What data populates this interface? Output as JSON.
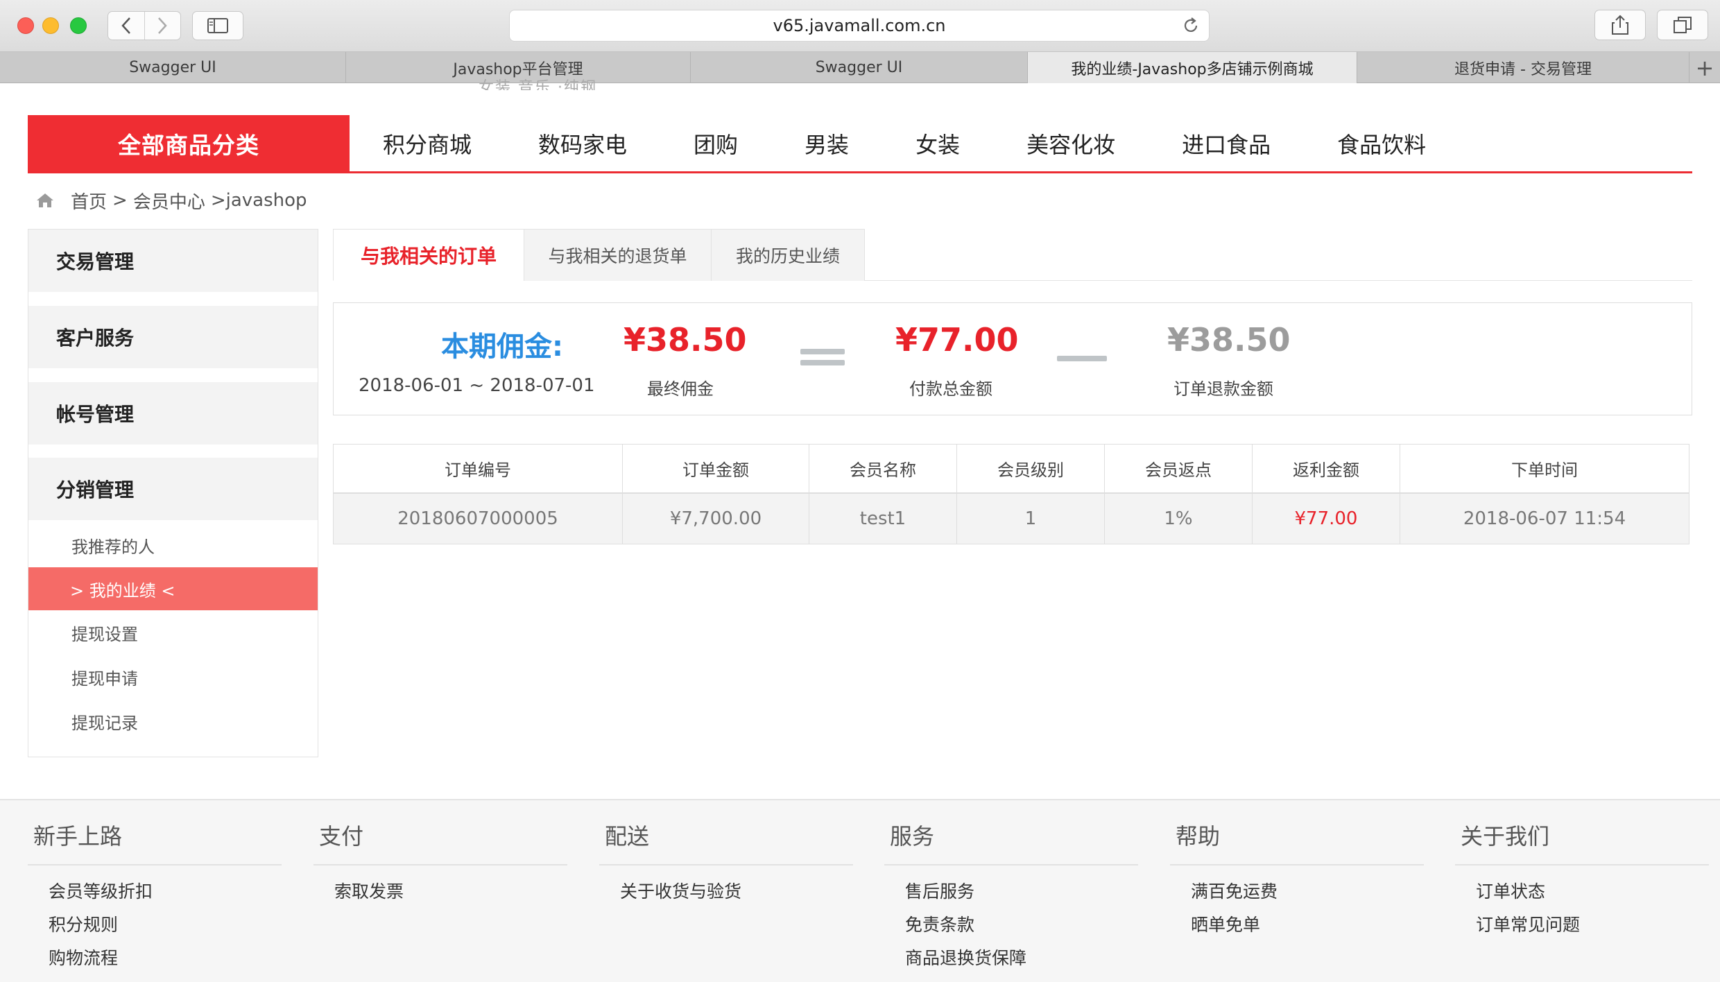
{
  "browser": {
    "url": "v65.javamall.com.cn",
    "tabs": [
      {
        "label": "Swagger UI"
      },
      {
        "label": "Javashop平台管理"
      },
      {
        "label": "Swagger UI"
      },
      {
        "label": "我的业绩-Javashop多店铺示例商城"
      },
      {
        "label": "退货申请 - 交易管理"
      }
    ],
    "new_tab": "+"
  },
  "header": {
    "clipped_links": "女装   音乐   ·纯钢",
    "all_categories": "全部商品分类",
    "nav": [
      "积分商城",
      "数码家电",
      "团购",
      "男装",
      "女装",
      "美容化妆",
      "进口食品",
      "食品饮料"
    ]
  },
  "breadcrumb": {
    "home": "首页",
    "sep1": ">",
    "member": "会员中心",
    "current": ">javashop"
  },
  "sidebar": {
    "sections": [
      "交易管理",
      "客户服务",
      "帐号管理",
      "分销管理"
    ],
    "items": [
      {
        "label": "我推荐的人"
      },
      {
        "label": "> 我的业绩 <"
      },
      {
        "label": "提现设置"
      },
      {
        "label": "提现申请"
      },
      {
        "label": "提现记录"
      }
    ]
  },
  "content_tabs": [
    "与我相关的订单",
    "与我相关的退货单",
    "我的历史业绩"
  ],
  "summary": {
    "label": "本期佣金:",
    "period": "2018-06-01 ~ 2018-07-01",
    "final": {
      "amount": "¥38.50",
      "caption": "最终佣金"
    },
    "total": {
      "amount": "¥77.00",
      "caption": "付款总金额"
    },
    "refund": {
      "amount": "¥38.50",
      "caption": "订单退款金额"
    }
  },
  "orders": {
    "columns": [
      "订单编号",
      "订单金额",
      "会员名称",
      "会员级别",
      "会员返点",
      "返利金额",
      "下单时间"
    ],
    "rows": [
      [
        "20180607000005",
        "¥7,700.00",
        "test1",
        "1",
        "1%",
        "¥77.00",
        "2018-06-07 11:54"
      ]
    ]
  },
  "footer": {
    "columns": [
      {
        "title": "新手上路",
        "links": [
          "会员等级折扣",
          "积分规则",
          "购物流程"
        ]
      },
      {
        "title": "支付",
        "links": [
          "索取发票"
        ]
      },
      {
        "title": "配送",
        "links": [
          "关于收货与验货"
        ]
      },
      {
        "title": "服务",
        "links": [
          "售后服务",
          "免责条款",
          "商品退换货保障"
        ]
      },
      {
        "title": "帮助",
        "links": [
          "满百免运费",
          "晒单免单"
        ]
      },
      {
        "title": "关于我们",
        "links": [
          "订单状态",
          "订单常见问题"
        ]
      }
    ]
  },
  "colors": {
    "brand_red": "#ef2d33",
    "active_menu": "#f56b67",
    "commission_blue": "#2a8de0"
  }
}
